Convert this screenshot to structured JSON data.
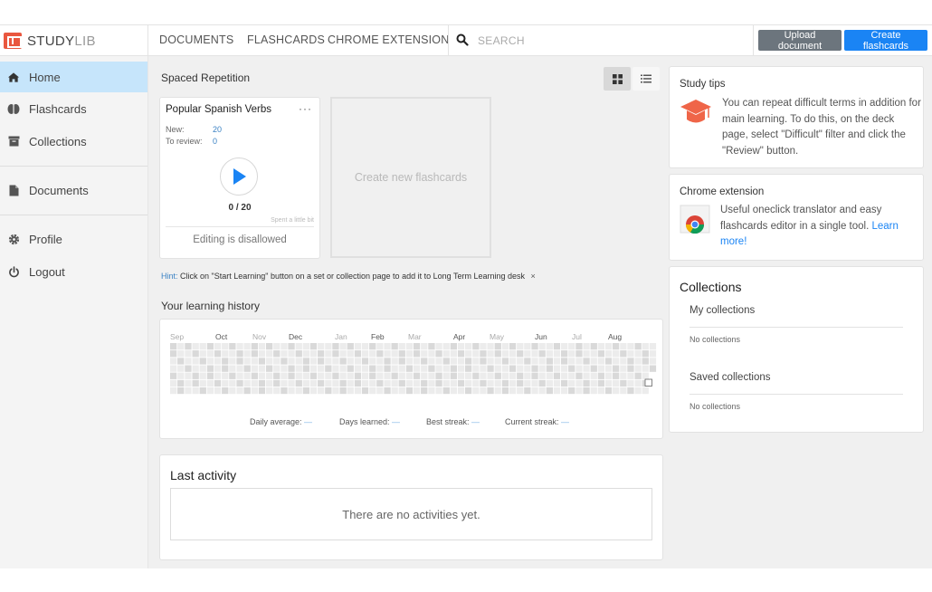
{
  "logo": {
    "part1": "STUDY",
    "part2": "LIB"
  },
  "nav": {
    "documents": "DOCUMENTS",
    "flashcards": "FLASHCARDS",
    "chrome": "CHROME EXTENSION",
    "search_placeholder": "SEARCH"
  },
  "buttons": {
    "upload": "Upload document",
    "create": "Create flashcards"
  },
  "sidebar": {
    "home": "Home",
    "flashcards": "Flashcards",
    "collections": "Collections",
    "documents": "Documents",
    "profile": "Profile",
    "logout": "Logout"
  },
  "spaced": {
    "title": "Spaced Repetition",
    "deck": {
      "title": "Popular Spanish Verbs",
      "menu": "···",
      "new_label": "New:",
      "new_value": "20",
      "review_label": "To review:",
      "review_value": "0",
      "progress": "0 / 20",
      "spent": "Spent a little bit",
      "footer": "Editing is disallowed"
    },
    "create_new": "Create new flashcards"
  },
  "hint": {
    "label": "Hint:",
    "text": "Click on \"Start Learning\" button on a set or collection page to add it to Long Term Learning desk",
    "close": "×"
  },
  "history": {
    "title": "Your learning history",
    "months": [
      "Sep",
      "Oct",
      "Nov",
      "Dec",
      "Jan",
      "Feb",
      "Mar",
      "Apr",
      "May",
      "Jun",
      "Jul",
      "Aug"
    ],
    "stats": {
      "daily": "Daily average:",
      "days": "Days learned:",
      "best": "Best streak:",
      "current": "Current streak:",
      "empty": "—"
    }
  },
  "activity": {
    "title": "Last activity",
    "empty": "There are no activities yet."
  },
  "study_tips": {
    "title": "Study tips",
    "text": "You can repeat difficult terms in addition for main learning. To do this, on the deck page, select \"Difficult\" filter and click the \"Review\" button."
  },
  "chrome_ext": {
    "title": "Chrome extension",
    "text": "Useful oneclick translator and easy flashcards editor in a single tool.",
    "link": "Learn more!"
  },
  "collections": {
    "title": "Collections",
    "my": "My collections",
    "my_empty": "No collections",
    "saved": "Saved collections",
    "saved_empty": "No collections"
  },
  "colors": {
    "accent": "#1a84f4",
    "brand": "#e9573f",
    "active_nav": "#c6e5fb",
    "heat_light": "#ececec",
    "heat_dark": "#d9d9d9"
  }
}
